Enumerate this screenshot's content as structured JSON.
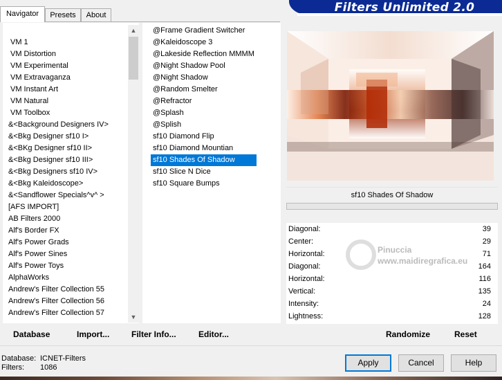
{
  "tabs": [
    {
      "label": "Navigator",
      "active": true
    },
    {
      "label": "Presets",
      "active": false
    },
    {
      "label": "About",
      "active": false
    }
  ],
  "app_title": "Filters Unlimited 2.0",
  "categories": [
    "VM 1",
    "VM Distortion",
    "VM Experimental",
    "VM Extravaganza",
    "VM Instant Art",
    "VM Natural",
    "VM Toolbox",
    "&<Background Designers IV>",
    "&<Bkg Designer sf10 I>",
    "&<BKg Designer sf10 II>",
    "&<Bkg Designer sf10 III>",
    "&<Bkg Designers sf10 IV>",
    "&<Bkg Kaleidoscope>",
    "&<Sandflower Specials^v^ >",
    "[AFS IMPORT]",
    "AB Filters 2000",
    "Alf's Border FX",
    "Alf's Power Grads",
    "Alf's Power Sines",
    "Alf's Power Toys",
    "AlphaWorks",
    "Andrew's Filter Collection 55",
    "Andrew's Filter Collection 56",
    "Andrew's Filter Collection 57"
  ],
  "filters": [
    "@Frame Gradient Switcher",
    "@Kaleidoscope 3",
    "@Lakeside Reflection MMMM",
    "@Night Shadow Pool",
    "@Night Shadow",
    "@Random Smelter",
    "@Refractor",
    "@Splash",
    "@Splish",
    "sf10 Diamond Flip",
    "sf10 Diamond Mountian",
    "sf10 Shades Of Shadow",
    "sf10 Slice N Dice",
    "sf10 Square Bumps"
  ],
  "selected_filter": "sf10 Shades Of Shadow",
  "preview_name": "sf10 Shades Of Shadow",
  "parameters": [
    {
      "label": "Diagonal:",
      "value": "39"
    },
    {
      "label": "Center:",
      "value": "29"
    },
    {
      "label": "Horizontal:",
      "value": "71"
    },
    {
      "label": "Diagonal:",
      "value": "164"
    },
    {
      "label": "Horizontal:",
      "value": "116"
    },
    {
      "label": "Vertical:",
      "value": "135"
    },
    {
      "label": "Intensity:",
      "value": "24"
    },
    {
      "label": "Lightness:",
      "value": "128"
    }
  ],
  "watermark": {
    "line1": "Pinuccia",
    "line2": "www.maidiregrafica.eu"
  },
  "links": {
    "database": "Database",
    "import": "Import...",
    "filter_info": "Filter Info...",
    "editor": "Editor...",
    "randomize": "Randomize",
    "reset": "Reset"
  },
  "status": {
    "database_label": "Database:",
    "database_value": "ICNET-Filters",
    "filters_label": "Filters:",
    "filters_value": "1086"
  },
  "buttons": {
    "apply": "Apply",
    "cancel": "Cancel",
    "help": "Help"
  },
  "colors": {
    "accent": "#0078d7",
    "banner": "#0b2a93"
  }
}
